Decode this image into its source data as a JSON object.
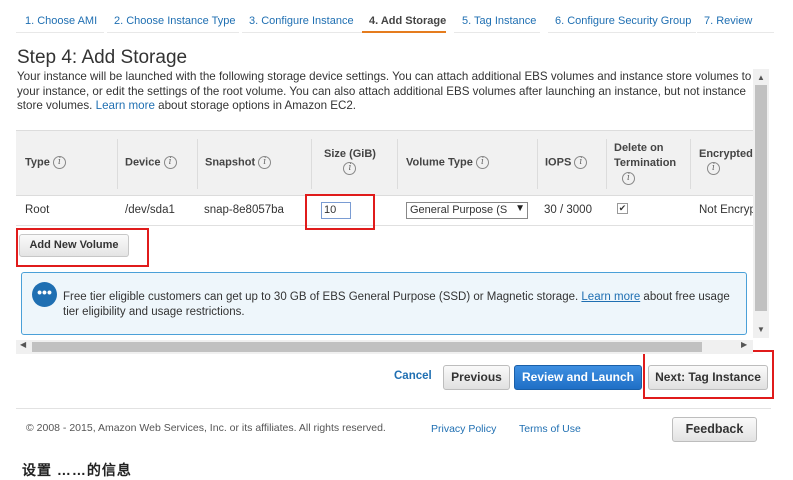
{
  "wizard": {
    "steps": [
      {
        "label": "1. Choose AMI"
      },
      {
        "label": "2. Choose Instance Type"
      },
      {
        "label": "3. Configure Instance"
      },
      {
        "label": "4. Add Storage"
      },
      {
        "label": "5. Tag Instance"
      },
      {
        "label": "6. Configure Security Group"
      },
      {
        "label": "7. Review"
      }
    ],
    "active_step": "4. Add Storage"
  },
  "page": {
    "title": "Step 4: Add Storage",
    "intro_text": "Your instance will be launched with the following storage device settings. You can attach additional EBS volumes and instance store volumes to your instance, or edit the settings of the root volume. You can also attach additional EBS volumes after launching an instance, but not instance store volumes.",
    "intro_link": "Learn more",
    "intro_suffix": "about storage options in Amazon EC2."
  },
  "table": {
    "headers": {
      "type": "Type",
      "device": "Device",
      "snapshot": "Snapshot",
      "size": "Size (GiB)",
      "volume_type": "Volume Type",
      "iops": "IOPS",
      "delete_on_termination": "Delete on Termination",
      "encrypted": "Encrypted"
    },
    "rows": [
      {
        "type": "Root",
        "device": "/dev/sda1",
        "snapshot": "snap-8e8057ba",
        "size": "10",
        "volume_type": "General Purpose (S",
        "iops": "30 / 3000",
        "delete_on_termination": true,
        "encrypted": "Not Encryp"
      }
    ]
  },
  "add_volume_label": "Add New Volume",
  "info_box": {
    "text": "Free tier eligible customers can get up to 30 GB of EBS General Purpose (SSD) or Magnetic storage.",
    "link": "Learn more",
    "suffix": "about free usage tier eligibility and usage restrictions."
  },
  "actions": {
    "cancel": "Cancel",
    "previous": "Previous",
    "review_launch": "Review and Launch",
    "next": "Next: Tag Instance"
  },
  "footer": {
    "copyright": "© 2008 - 2015, Amazon Web Services, Inc. or its affiliates. All rights reserved.",
    "privacy": "Privacy Policy",
    "terms": "Terms of Use",
    "feedback": "Feedback"
  },
  "bottom_cut_text": "设置 ……的信息",
  "colors": {
    "link": "#1f6fb2",
    "active_step_underline": "#e57c1e",
    "primary_button": "#1f6fc6",
    "highlight_box": "#e01b1b"
  }
}
